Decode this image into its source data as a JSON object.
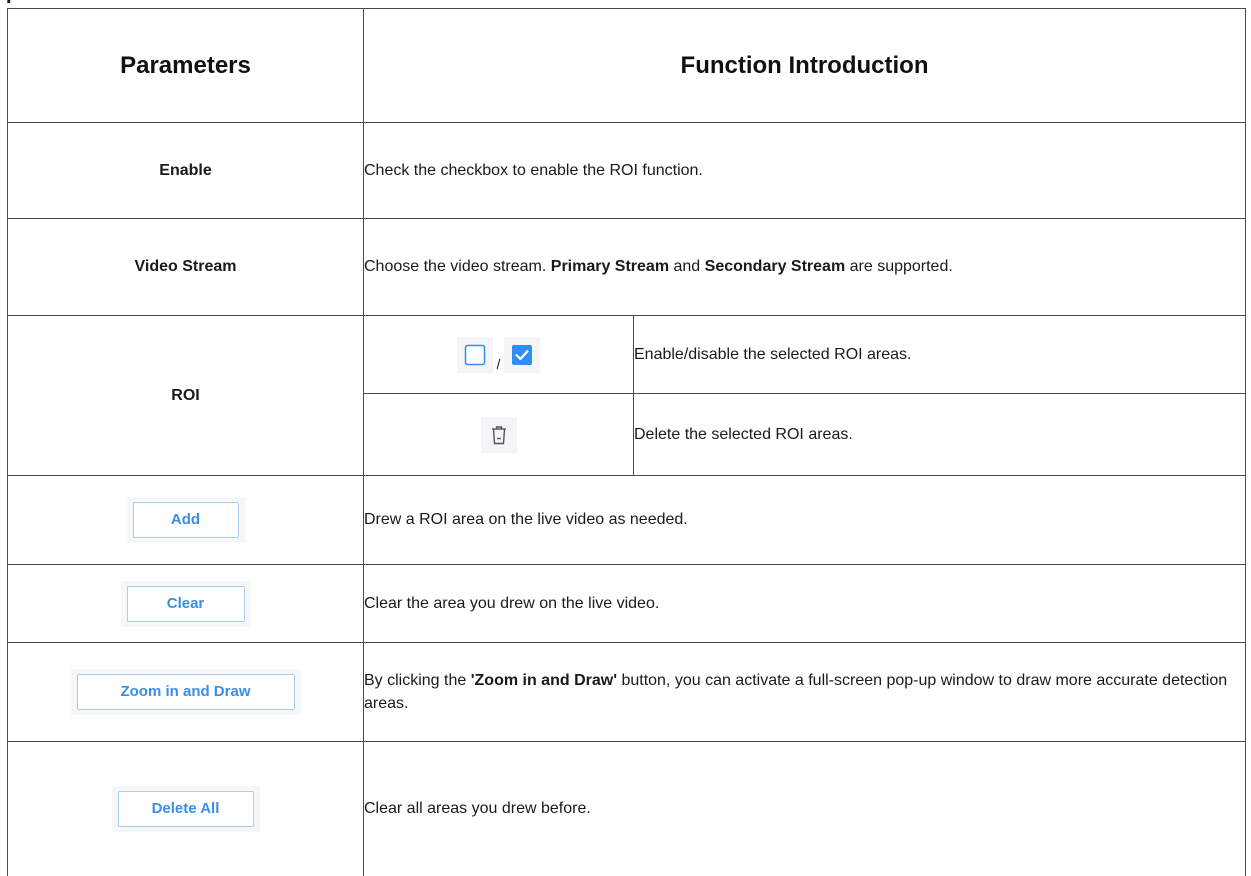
{
  "page": {
    "clipped_heading": "   ."
  },
  "table": {
    "headers": {
      "parameters": "Parameters",
      "function": "Function Introduction"
    },
    "enable": {
      "param": "Enable",
      "desc": "Check the checkbox to enable the ROI function."
    },
    "video_stream": {
      "param": "Video Stream",
      "desc_pre": "Choose the video stream. ",
      "desc_bold1": "Primary Stream",
      "desc_mid": " and ",
      "desc_bold2": "Secondary Stream",
      "desc_post": " are supported."
    },
    "roi": {
      "param": "ROI",
      "slash": "/",
      "checkbox_desc": "Enable/disable the selected ROI areas.",
      "delete_desc": "Delete the selected ROI areas."
    },
    "add": {
      "button_label": "Add",
      "desc": "Drew a ROI area on the live video as needed."
    },
    "clear": {
      "button_label": "Clear",
      "desc": "Clear the area you drew on the live video."
    },
    "zoom": {
      "button_label": "Zoom in and Draw",
      "desc_pre": "By clicking the ",
      "desc_bold": "'Zoom in and Draw'",
      "desc_post": " button, you can activate a full-screen pop-up window to draw more accurate detection areas."
    },
    "delete_all": {
      "button_label": "Delete All",
      "desc": "Clear all areas you drew before."
    }
  },
  "icons": {
    "unchecked": "checkbox-unchecked-icon",
    "checked": "checkbox-checked-icon",
    "trash": "trash-icon"
  },
  "colors": {
    "accent": "#2f8ef0",
    "button_text": "#3a8ee6",
    "button_border": "#a9cdf0",
    "border": "#4a4a4a"
  }
}
